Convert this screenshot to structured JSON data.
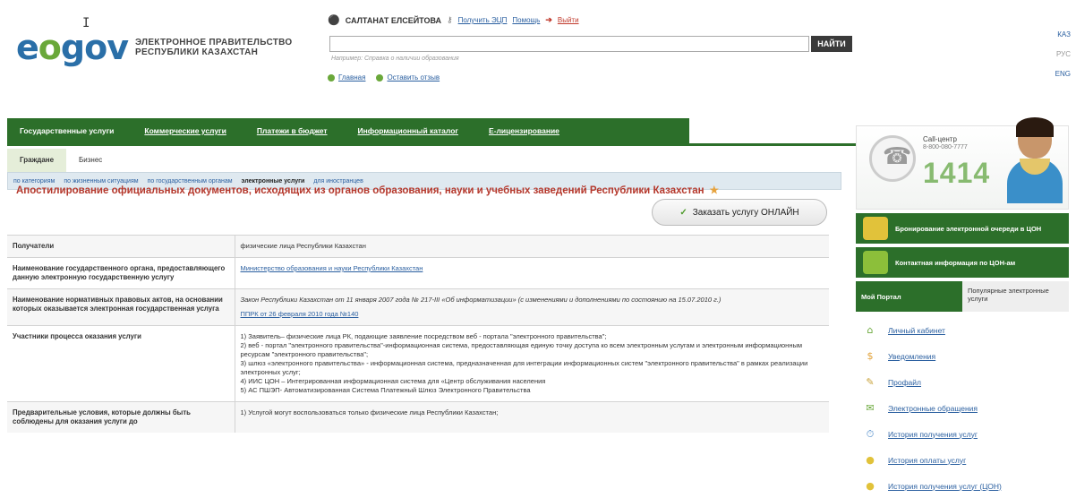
{
  "header": {
    "logo_text": "eGOV",
    "logo_e": "e",
    "logo_o": "o",
    "logo_gov": "gov",
    "org_line1": "ЭЛЕКТРОННОЕ ПРАВИТЕЛЬСТВО",
    "org_line2": "РЕСПУБЛИКИ КАЗАХСТАН"
  },
  "userbar": {
    "user_name": "САЛТАНАТ ЕЛСЕЙТОВА",
    "get_eds": "Получить ЭЦП",
    "help": "Помощь",
    "logout": "Выйти"
  },
  "search": {
    "button_label": "НАЙТИ",
    "hint": "Например: Справка о наличии образования"
  },
  "quicklinks": {
    "home": "Главная",
    "feedback": "Оставить отзыв"
  },
  "langs": [
    "КАЗ",
    "РУС",
    "ENG"
  ],
  "mainnav": {
    "items": [
      "Государственные услуги",
      "Коммерческие услуги",
      "Платежи в бюджет",
      "Информационный каталог",
      "Е-лицензирование"
    ]
  },
  "subtabs": [
    "Граждане",
    "Бизнес"
  ],
  "filters": [
    "по категориям",
    "по жизненным ситуациям",
    "по государственным органам",
    "электронные услуги",
    "для иностранцев"
  ],
  "service": {
    "title": "Апостилирование официальных документов, исходящих из органов образования, науки и учебных заведений Республики Казахстан",
    "order_button": "Заказать услугу ОНЛАЙН"
  },
  "table": {
    "rows": [
      {
        "label": "Получатели",
        "value": "физические лица Республики Казахстан"
      },
      {
        "label": "Наименование государственного органа, предоставляющего данную электронную государственную услугу",
        "value": "Министерство образования и науки Республики Казахстан"
      },
      {
        "label": "Наименование нормативных правовых актов, на основании которых оказывается электронная государственная услуга",
        "value_line1": "Закон Республики Казахстан от 11 января 2007 года № 217-III «Об информатизации» (с изменениями и дополнениями по состоянию на 15.07.2010 г.)",
        "value_line2": "ППРК от 26 февраля 2010 года №140"
      },
      {
        "label": "Участники процесса оказания услуги",
        "lines": [
          "1) Заявитель– физические лица РК, подающие заявление посредством веб - портала \"электронного правительства\";",
          "2) веб - портал \"электронного правительства\"-информационная система, предоставляющая единую точку доступа ко всем электронным услугам и электронным информационным ресурсам \"электронного правительства\";",
          "3) шлюз «электронного правительства» - информационная система, предназначенная для интеграции информационных систем \"электронного правительства\" в рамках реализации электронных услуг;",
          "4) ИИС ЦОН – Интегрированная информационная система для «Центр обслуживания населения",
          "5) АС ПШЭП- Автоматизированная Система Платежный Шлюз Электронного Правительства"
        ]
      },
      {
        "label": "Предварительные условия, которые должны быть соблюдены для оказания услуги до",
        "value": "1) Услугой могут воспользоваться только физические лица Республики Казахстан;"
      }
    ]
  },
  "sidebar": {
    "callcenter_title": "Call-центр",
    "callcenter_phone": "8-800-080-7777",
    "callcenter_short": "1414",
    "promo1": "Бронирование электронной очереди в ЦОН",
    "promo2": "Контактная информация по ЦОН-ам",
    "tab_active": "Мой Портал",
    "tab_inactive": "Популярные электронные услуги",
    "items": [
      "Личный кабинет",
      "Уведомления",
      "Профайл",
      "Электронные обращения",
      "История получения услуг",
      "История оплаты услуг",
      "История получения услуг (ЦОН)"
    ]
  },
  "colors": {
    "green": "#2c6f2a",
    "title_red": "#b5382c",
    "link_blue": "#2a5fa0",
    "logo_blue": "#2a6fa8"
  }
}
